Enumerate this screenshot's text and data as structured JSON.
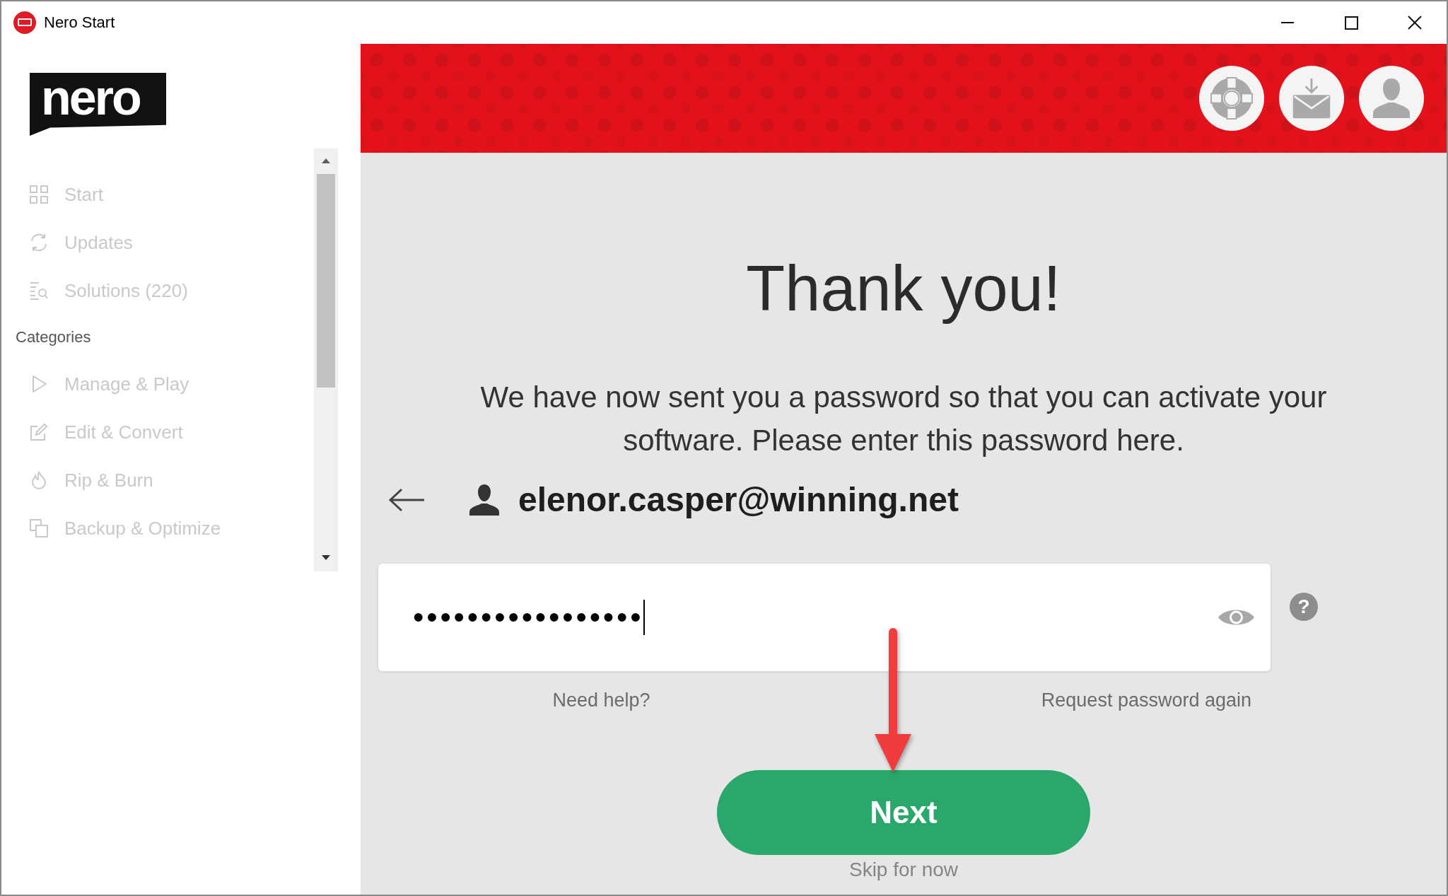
{
  "window": {
    "title": "Nero Start"
  },
  "sidebar": {
    "logo": "nero",
    "items": [
      {
        "label": "Start",
        "disabled": true
      },
      {
        "label": "Updates",
        "disabled": true
      },
      {
        "label": "Solutions (220)",
        "disabled": true
      }
    ],
    "categories": {
      "heading": "Categories",
      "items": [
        {
          "label": "Manage & Play",
          "disabled": true
        },
        {
          "label": "Edit & Convert",
          "disabled": true
        },
        {
          "label": "Rip & Burn",
          "disabled": true
        },
        {
          "label": "Backup & Optimize",
          "disabled": true
        }
      ]
    }
  },
  "main": {
    "title": "Thank you!",
    "message": "We have now sent you a password so that you can activate your software. Please enter this password here.",
    "account": {
      "email": "elenor.casper@winning.net"
    },
    "password_field": {
      "value": "•••••••••••••••••",
      "focused": true
    },
    "help_button": {
      "label": "?"
    },
    "links": [
      "Need help?",
      "Request password again"
    ],
    "next_button": {
      "label": "Next"
    },
    "skip_link": "Skip for now"
  }
}
